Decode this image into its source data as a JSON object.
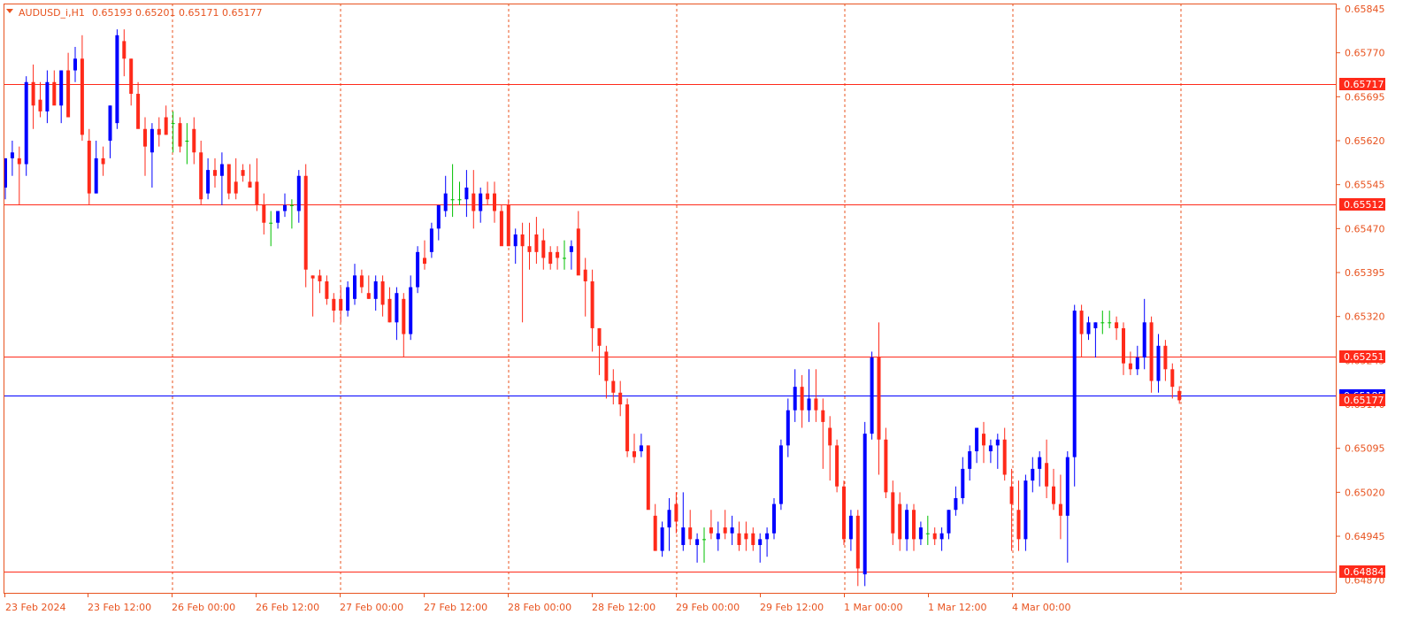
{
  "title": {
    "symbol": "AUDUSD_i,H1",
    "ohlc": "0.65193 0.65201 0.65171 0.65177"
  },
  "colors": {
    "background": "#ffffff",
    "axis": "#e8531f",
    "grid": "#e8531f",
    "bull_candle": "#0000ff",
    "bear_candle": "#ff2a1a",
    "doji_candle": "#00c000",
    "horizontal_line": "#ff2a1a",
    "bid_line": "#0000ff",
    "price_tag": "#ff2a1a"
  },
  "price_axis": {
    "ticks": [
      "0.65845",
      "0.65770",
      "0.65695",
      "0.65620",
      "0.65545",
      "0.65470",
      "0.65395",
      "0.65320",
      "0.65095",
      "0.65020",
      "0.64945"
    ],
    "hidden_ticks": [
      "0.65245",
      "0.65170",
      "0.64870"
    ]
  },
  "time_axis": {
    "labels": [
      "23 Feb 2024",
      "23 Feb 12:00",
      "26 Feb 00:00",
      "26 Feb 12:00",
      "27 Feb 00:00",
      "27 Feb 12:00",
      "28 Feb 00:00",
      "28 Feb 12:00",
      "29 Feb 00:00",
      "29 Feb 12:00",
      "1 Mar 00:00",
      "1 Mar 12:00",
      "4 Mar 00:00"
    ]
  },
  "levels": [
    {
      "price": 0.65717,
      "label": "0.65717"
    },
    {
      "price": 0.65512,
      "label": "0.65512"
    },
    {
      "price": 0.65251,
      "label": "0.65251"
    },
    {
      "price": 0.64884,
      "label": "0.64884"
    }
  ],
  "bid": {
    "price": 0.65185,
    "label": "0.65185"
  },
  "current_price": {
    "price": 0.65177,
    "label": "0.65177"
  },
  "chart_data": {
    "type": "candlestick",
    "timeframe": "H1",
    "ylim": [
      0.6486,
      0.6585
    ],
    "bars": [
      {
        "o": 0.6554,
        "h": 0.6559,
        "l": 0.6552,
        "c": 0.6559
      },
      {
        "o": 0.6559,
        "h": 0.6562,
        "l": 0.6556,
        "c": 0.656
      },
      {
        "o": 0.6559,
        "h": 0.6561,
        "l": 0.6551,
        "c": 0.6558
      },
      {
        "o": 0.6558,
        "h": 0.6573,
        "l": 0.6556,
        "c": 0.6572
      },
      {
        "o": 0.6572,
        "h": 0.6575,
        "l": 0.6564,
        "c": 0.6568
      },
      {
        "o": 0.6569,
        "h": 0.6572,
        "l": 0.6566,
        "c": 0.6567
      },
      {
        "o": 0.6567,
        "h": 0.6574,
        "l": 0.6565,
        "c": 0.6572
      },
      {
        "o": 0.6572,
        "h": 0.6574,
        "l": 0.6569,
        "c": 0.6568
      },
      {
        "o": 0.6568,
        "h": 0.6574,
        "l": 0.6565,
        "c": 0.6574
      },
      {
        "o": 0.6574,
        "h": 0.6577,
        "l": 0.6566,
        "c": 0.6566
      },
      {
        "o": 0.6574,
        "h": 0.6578,
        "l": 0.6572,
        "c": 0.6576
      },
      {
        "o": 0.6576,
        "h": 0.658,
        "l": 0.6562,
        "c": 0.6563
      },
      {
        "o": 0.6562,
        "h": 0.6564,
        "l": 0.6551,
        "c": 0.6553
      },
      {
        "o": 0.6553,
        "h": 0.6562,
        "l": 0.6553,
        "c": 0.6559
      },
      {
        "o": 0.6559,
        "h": 0.6561,
        "l": 0.6556,
        "c": 0.6558
      },
      {
        "o": 0.6562,
        "h": 0.6568,
        "l": 0.6559,
        "c": 0.6568
      },
      {
        "o": 0.6565,
        "h": 0.6581,
        "l": 0.6564,
        "c": 0.658
      },
      {
        "o": 0.6579,
        "h": 0.6581,
        "l": 0.6573,
        "c": 0.6576
      },
      {
        "o": 0.6576,
        "h": 0.6576,
        "l": 0.6568,
        "c": 0.657
      },
      {
        "o": 0.657,
        "h": 0.6572,
        "l": 0.6565,
        "c": 0.6564
      },
      {
        "o": 0.6564,
        "h": 0.6566,
        "l": 0.6556,
        "c": 0.6561
      },
      {
        "o": 0.656,
        "h": 0.6565,
        "l": 0.6554,
        "c": 0.6564
      },
      {
        "o": 0.6564,
        "h": 0.6566,
        "l": 0.6561,
        "c": 0.6563
      },
      {
        "o": 0.6566,
        "h": 0.6568,
        "l": 0.6563,
        "c": 0.6563
      },
      {
        "o": 0.6565,
        "h": 0.6567,
        "l": 0.656,
        "c": 0.6565
      },
      {
        "o": 0.6565,
        "h": 0.6566,
        "l": 0.656,
        "c": 0.6561
      },
      {
        "o": 0.6562,
        "h": 0.6565,
        "l": 0.6558,
        "c": 0.6562
      },
      {
        "o": 0.6564,
        "h": 0.6566,
        "l": 0.6558,
        "c": 0.656
      },
      {
        "o": 0.656,
        "h": 0.6562,
        "l": 0.6551,
        "c": 0.6552
      },
      {
        "o": 0.6553,
        "h": 0.6559,
        "l": 0.6552,
        "c": 0.6557
      },
      {
        "o": 0.6557,
        "h": 0.6559,
        "l": 0.6554,
        "c": 0.6556
      },
      {
        "o": 0.6556,
        "h": 0.656,
        "l": 0.6551,
        "c": 0.6558
      },
      {
        "o": 0.6558,
        "h": 0.6558,
        "l": 0.6552,
        "c": 0.6553
      },
      {
        "o": 0.6555,
        "h": 0.6559,
        "l": 0.6552,
        "c": 0.6553
      },
      {
        "o": 0.6557,
        "h": 0.6558,
        "l": 0.6555,
        "c": 0.6556
      },
      {
        "o": 0.6555,
        "h": 0.6558,
        "l": 0.6554,
        "c": 0.6554
      },
      {
        "o": 0.6555,
        "h": 0.6559,
        "l": 0.655,
        "c": 0.6551
      },
      {
        "o": 0.6551,
        "h": 0.6553,
        "l": 0.6546,
        "c": 0.6548
      },
      {
        "o": 0.6548,
        "h": 0.655,
        "l": 0.6544,
        "c": 0.6548
      },
      {
        "o": 0.6548,
        "h": 0.655,
        "l": 0.6547,
        "c": 0.655
      },
      {
        "o": 0.655,
        "h": 0.6553,
        "l": 0.6549,
        "c": 0.6551
      },
      {
        "o": 0.6551,
        "h": 0.6552,
        "l": 0.6547,
        "c": 0.6551
      },
      {
        "o": 0.655,
        "h": 0.6557,
        "l": 0.6548,
        "c": 0.6556
      },
      {
        "o": 0.6556,
        "h": 0.6558,
        "l": 0.6537,
        "c": 0.654
      },
      {
        "o": 0.6539,
        "h": 0.6539,
        "l": 0.6532,
        "c": 0.65385
      },
      {
        "o": 0.6539,
        "h": 0.654,
        "l": 0.6536,
        "c": 0.6538
      },
      {
        "o": 0.6538,
        "h": 0.6539,
        "l": 0.6534,
        "c": 0.6535
      },
      {
        "o": 0.6535,
        "h": 0.6536,
        "l": 0.6531,
        "c": 0.6533
      },
      {
        "o": 0.6535,
        "h": 0.6537,
        "l": 0.6531,
        "c": 0.6533
      },
      {
        "o": 0.6533,
        "h": 0.6538,
        "l": 0.6532,
        "c": 0.6537
      },
      {
        "o": 0.6535,
        "h": 0.6541,
        "l": 0.6534,
        "c": 0.6539
      },
      {
        "o": 0.6539,
        "h": 0.654,
        "l": 0.6536,
        "c": 0.6537
      },
      {
        "o": 0.6536,
        "h": 0.6539,
        "l": 0.6535,
        "c": 0.6535
      },
      {
        "o": 0.6535,
        "h": 0.6539,
        "l": 0.6533,
        "c": 0.6538
      },
      {
        "o": 0.6538,
        "h": 0.6539,
        "l": 0.6532,
        "c": 0.6534
      },
      {
        "o": 0.6535,
        "h": 0.6537,
        "l": 0.6531,
        "c": 0.6531
      },
      {
        "o": 0.6531,
        "h": 0.6537,
        "l": 0.6528,
        "c": 0.6536
      },
      {
        "o": 0.6535,
        "h": 0.6536,
        "l": 0.6525,
        "c": 0.6529
      },
      {
        "o": 0.6529,
        "h": 0.6539,
        "l": 0.6528,
        "c": 0.6537
      },
      {
        "o": 0.6537,
        "h": 0.6544,
        "l": 0.6536,
        "c": 0.6543
      },
      {
        "o": 0.6542,
        "h": 0.6545,
        "l": 0.654,
        "c": 0.6541
      },
      {
        "o": 0.6543,
        "h": 0.6548,
        "l": 0.6542,
        "c": 0.6547
      },
      {
        "o": 0.6547,
        "h": 0.6551,
        "l": 0.6545,
        "c": 0.6551
      },
      {
        "o": 0.655,
        "h": 0.6556,
        "l": 0.6549,
        "c": 0.6553
      },
      {
        "o": 0.6552,
        "h": 0.6558,
        "l": 0.6549,
        "c": 0.6552
      },
      {
        "o": 0.6552,
        "h": 0.6555,
        "l": 0.6551,
        "c": 0.6552
      },
      {
        "o": 0.6552,
        "h": 0.6557,
        "l": 0.6549,
        "c": 0.6554
      },
      {
        "o": 0.6553,
        "h": 0.6557,
        "l": 0.6547,
        "c": 0.655
      },
      {
        "o": 0.655,
        "h": 0.6554,
        "l": 0.6548,
        "c": 0.6553
      },
      {
        "o": 0.6553,
        "h": 0.6555,
        "l": 0.6551,
        "c": 0.6552
      },
      {
        "o": 0.6553,
        "h": 0.6555,
        "l": 0.6548,
        "c": 0.655
      },
      {
        "o": 0.655,
        "h": 0.6551,
        "l": 0.6545,
        "c": 0.6544
      },
      {
        "o": 0.6551,
        "h": 0.6552,
        "l": 0.6544,
        "c": 0.6544
      },
      {
        "o": 0.6544,
        "h": 0.6547,
        "l": 0.6541,
        "c": 0.6546
      },
      {
        "o": 0.6546,
        "h": 0.6548,
        "l": 0.6531,
        "c": 0.6544
      },
      {
        "o": 0.6544,
        "h": 0.6548,
        "l": 0.654,
        "c": 0.6543
      },
      {
        "o": 0.6546,
        "h": 0.6549,
        "l": 0.6541,
        "c": 0.6543
      },
      {
        "o": 0.6545,
        "h": 0.6547,
        "l": 0.654,
        "c": 0.6542
      },
      {
        "o": 0.6543,
        "h": 0.6544,
        "l": 0.654,
        "c": 0.6541
      },
      {
        "o": 0.6543,
        "h": 0.6544,
        "l": 0.654,
        "c": 0.6542
      },
      {
        "o": 0.6542,
        "h": 0.6545,
        "l": 0.654,
        "c": 0.6542
      },
      {
        "o": 0.6543,
        "h": 0.6545,
        "l": 0.654,
        "c": 0.6544
      },
      {
        "o": 0.6547,
        "h": 0.655,
        "l": 0.6541,
        "c": 0.6539
      },
      {
        "o": 0.654,
        "h": 0.6542,
        "l": 0.6532,
        "c": 0.6538
      },
      {
        "o": 0.6538,
        "h": 0.654,
        "l": 0.6526,
        "c": 0.653
      },
      {
        "o": 0.653,
        "h": 0.653,
        "l": 0.6522,
        "c": 0.6527
      },
      {
        "o": 0.6526,
        "h": 0.6527,
        "l": 0.6518,
        "c": 0.6521
      },
      {
        "o": 0.6521,
        "h": 0.6523,
        "l": 0.6517,
        "c": 0.6519
      },
      {
        "o": 0.6519,
        "h": 0.6521,
        "l": 0.6515,
        "c": 0.6517
      },
      {
        "o": 0.6517,
        "h": 0.6518,
        "l": 0.6508,
        "c": 0.6509
      },
      {
        "o": 0.6509,
        "h": 0.6512,
        "l": 0.6507,
        "c": 0.6508
      },
      {
        "o": 0.6509,
        "h": 0.6512,
        "l": 0.6508,
        "c": 0.651
      },
      {
        "o": 0.651,
        "h": 0.651,
        "l": 0.65,
        "c": 0.6499
      },
      {
        "o": 0.6498,
        "h": 0.65,
        "l": 0.6492,
        "c": 0.6492
      },
      {
        "o": 0.6492,
        "h": 0.6497,
        "l": 0.6491,
        "c": 0.6496
      },
      {
        "o": 0.6496,
        "h": 0.6501,
        "l": 0.6492,
        "c": 0.6499
      },
      {
        "o": 0.65,
        "h": 0.6502,
        "l": 0.6495,
        "c": 0.6497
      },
      {
        "o": 0.6493,
        "h": 0.6502,
        "l": 0.6492,
        "c": 0.6496
      },
      {
        "o": 0.6496,
        "h": 0.6499,
        "l": 0.6493,
        "c": 0.6494
      },
      {
        "o": 0.6493,
        "h": 0.6495,
        "l": 0.649,
        "c": 0.6494
      },
      {
        "o": 0.6494,
        "h": 0.6496,
        "l": 0.649,
        "c": 0.6494
      },
      {
        "o": 0.6496,
        "h": 0.6499,
        "l": 0.6494,
        "c": 0.6495
      },
      {
        "o": 0.6494,
        "h": 0.6497,
        "l": 0.6492,
        "c": 0.6495
      },
      {
        "o": 0.6496,
        "h": 0.6499,
        "l": 0.6494,
        "c": 0.6495
      },
      {
        "o": 0.6495,
        "h": 0.6498,
        "l": 0.6493,
        "c": 0.6496
      },
      {
        "o": 0.6495,
        "h": 0.6497,
        "l": 0.6492,
        "c": 0.6493
      },
      {
        "o": 0.6495,
        "h": 0.6497,
        "l": 0.6492,
        "c": 0.6494
      },
      {
        "o": 0.6495,
        "h": 0.6496,
        "l": 0.6492,
        "c": 0.6493
      },
      {
        "o": 0.6493,
        "h": 0.6495,
        "l": 0.649,
        "c": 0.6494
      },
      {
        "o": 0.6494,
        "h": 0.6496,
        "l": 0.6491,
        "c": 0.6495
      },
      {
        "o": 0.6495,
        "h": 0.6501,
        "l": 0.6494,
        "c": 0.65
      },
      {
        "o": 0.65,
        "h": 0.6511,
        "l": 0.6499,
        "c": 0.651
      },
      {
        "o": 0.651,
        "h": 0.6518,
        "l": 0.6508,
        "c": 0.6516
      },
      {
        "o": 0.6516,
        "h": 0.6523,
        "l": 0.6514,
        "c": 0.652
      },
      {
        "o": 0.652,
        "h": 0.6522,
        "l": 0.6513,
        "c": 0.6516
      },
      {
        "o": 0.6516,
        "h": 0.6523,
        "l": 0.6514,
        "c": 0.6518
      },
      {
        "o": 0.6518,
        "h": 0.6523,
        "l": 0.6514,
        "c": 0.6516
      },
      {
        "o": 0.6516,
        "h": 0.6518,
        "l": 0.6506,
        "c": 0.6514
      },
      {
        "o": 0.6513,
        "h": 0.6515,
        "l": 0.6504,
        "c": 0.651
      },
      {
        "o": 0.651,
        "h": 0.6511,
        "l": 0.6502,
        "c": 0.6503
      },
      {
        "o": 0.6503,
        "h": 0.6504,
        "l": 0.6493,
        "c": 0.6494
      },
      {
        "o": 0.6494,
        "h": 0.6499,
        "l": 0.6492,
        "c": 0.6498
      },
      {
        "o": 0.6498,
        "h": 0.6499,
        "l": 0.6486,
        "c": 0.6489
      },
      {
        "o": 0.6488,
        "h": 0.6514,
        "l": 0.6486,
        "c": 0.6512
      },
      {
        "o": 0.6512,
        "h": 0.6526,
        "l": 0.6511,
        "c": 0.6525
      },
      {
        "o": 0.6525,
        "h": 0.6531,
        "l": 0.6505,
        "c": 0.6511
      },
      {
        "o": 0.6511,
        "h": 0.6513,
        "l": 0.6501,
        "c": 0.6502
      },
      {
        "o": 0.6502,
        "h": 0.6504,
        "l": 0.6493,
        "c": 0.6495
      },
      {
        "o": 0.65,
        "h": 0.6502,
        "l": 0.6492,
        "c": 0.6494
      },
      {
        "o": 0.6494,
        "h": 0.65,
        "l": 0.6492,
        "c": 0.6499
      },
      {
        "o": 0.6499,
        "h": 0.65,
        "l": 0.6492,
        "c": 0.6494
      },
      {
        "o": 0.6494,
        "h": 0.6497,
        "l": 0.6493,
        "c": 0.6496
      },
      {
        "o": 0.6495,
        "h": 0.6498,
        "l": 0.6493,
        "c": 0.6495
      },
      {
        "o": 0.6495,
        "h": 0.6496,
        "l": 0.6493,
        "c": 0.6494
      },
      {
        "o": 0.6494,
        "h": 0.6496,
        "l": 0.6492,
        "c": 0.6495
      },
      {
        "o": 0.6495,
        "h": 0.6499,
        "l": 0.6494,
        "c": 0.6499
      },
      {
        "o": 0.6499,
        "h": 0.6503,
        "l": 0.6498,
        "c": 0.6501
      },
      {
        "o": 0.6501,
        "h": 0.6508,
        "l": 0.65,
        "c": 0.6506
      },
      {
        "o": 0.6506,
        "h": 0.651,
        "l": 0.6504,
        "c": 0.6509
      },
      {
        "o": 0.6509,
        "h": 0.6513,
        "l": 0.6507,
        "c": 0.6513
      },
      {
        "o": 0.6512,
        "h": 0.6514,
        "l": 0.6507,
        "c": 0.651
      },
      {
        "o": 0.6509,
        "h": 0.6511,
        "l": 0.6507,
        "c": 0.651
      },
      {
        "o": 0.651,
        "h": 0.6512,
        "l": 0.6506,
        "c": 0.6511
      },
      {
        "o": 0.6511,
        "h": 0.6513,
        "l": 0.6504,
        "c": 0.6505
      },
      {
        "o": 0.6503,
        "h": 0.6506,
        "l": 0.6492,
        "c": 0.65
      },
      {
        "o": 0.6499,
        "h": 0.6504,
        "l": 0.6492,
        "c": 0.6494
      },
      {
        "o": 0.6494,
        "h": 0.6505,
        "l": 0.6492,
        "c": 0.6504
      },
      {
        "o": 0.6504,
        "h": 0.6508,
        "l": 0.6502,
        "c": 0.6506
      },
      {
        "o": 0.6506,
        "h": 0.6509,
        "l": 0.6503,
        "c": 0.6508
      },
      {
        "o": 0.6507,
        "h": 0.6511,
        "l": 0.6501,
        "c": 0.6503
      },
      {
        "o": 0.6503,
        "h": 0.6506,
        "l": 0.6499,
        "c": 0.65
      },
      {
        "o": 0.65,
        "h": 0.6505,
        "l": 0.6494,
        "c": 0.6498
      },
      {
        "o": 0.6498,
        "h": 0.6509,
        "l": 0.649,
        "c": 0.6508
      },
      {
        "o": 0.6508,
        "h": 0.6534,
        "l": 0.6503,
        "c": 0.6533
      },
      {
        "o": 0.6533,
        "h": 0.6534,
        "l": 0.6525,
        "c": 0.6529
      },
      {
        "o": 0.6529,
        "h": 0.6532,
        "l": 0.6528,
        "c": 0.6531
      },
      {
        "o": 0.653,
        "h": 0.6531,
        "l": 0.6525,
        "c": 0.6531
      },
      {
        "o": 0.6531,
        "h": 0.6533,
        "l": 0.6529,
        "c": 0.6531
      },
      {
        "o": 0.6531,
        "h": 0.6533,
        "l": 0.653,
        "c": 0.6531
      },
      {
        "o": 0.6531,
        "h": 0.6532,
        "l": 0.6528,
        "c": 0.653
      },
      {
        "o": 0.653,
        "h": 0.6531,
        "l": 0.6522,
        "c": 0.6524
      },
      {
        "o": 0.6524,
        "h": 0.6526,
        "l": 0.6522,
        "c": 0.6523
      },
      {
        "o": 0.6523,
        "h": 0.6527,
        "l": 0.6522,
        "c": 0.6525
      },
      {
        "o": 0.6525,
        "h": 0.6535,
        "l": 0.6523,
        "c": 0.6531
      },
      {
        "o": 0.6531,
        "h": 0.6532,
        "l": 0.6519,
        "c": 0.6521
      },
      {
        "o": 0.6521,
        "h": 0.6529,
        "l": 0.6519,
        "c": 0.6527
      },
      {
        "o": 0.6527,
        "h": 0.6528,
        "l": 0.6521,
        "c": 0.6523
      },
      {
        "o": 0.6523,
        "h": 0.6524,
        "l": 0.6518,
        "c": 0.652
      },
      {
        "o": 0.65193,
        "h": 0.65201,
        "l": 0.65171,
        "c": 0.65177
      }
    ]
  }
}
